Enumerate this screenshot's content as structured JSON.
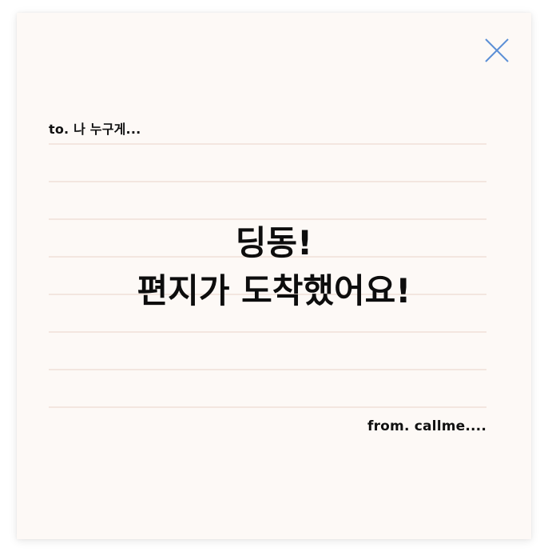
{
  "letter": {
    "to": "to. 나 누구게...",
    "message_line1": "딩동!",
    "message_line2": "편지가 도착했어요!",
    "from": "from. callme...."
  },
  "icons": {
    "close": "close-icon"
  },
  "colors": {
    "card_background": "#fdf9f6",
    "rule_line": "#f3e6df",
    "close_icon": "#5b8fd6",
    "text": "#0d0d0d"
  }
}
